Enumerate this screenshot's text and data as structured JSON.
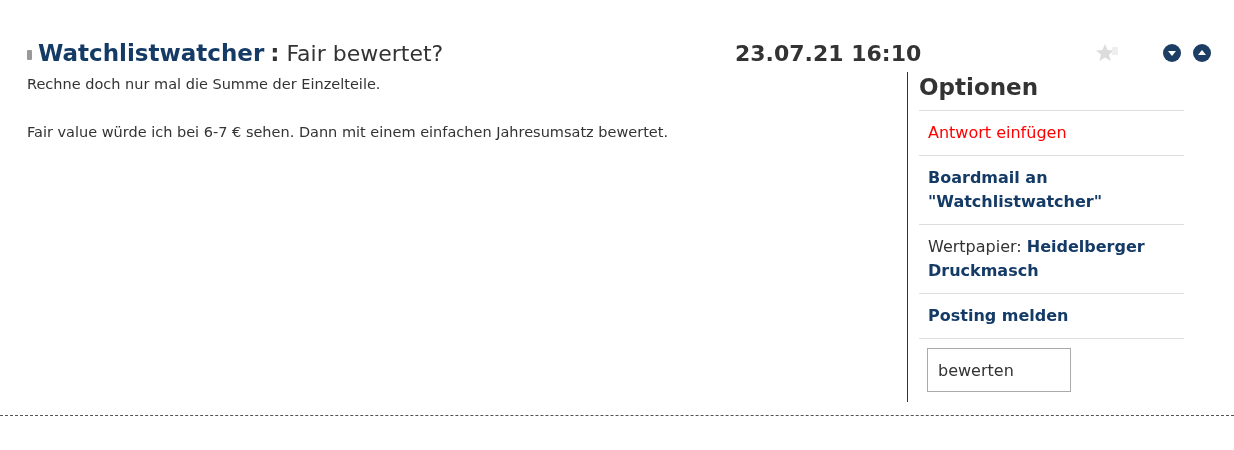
{
  "post": {
    "author": "Watchlistwatcher",
    "separator": ":",
    "title": "Fair bewertet?",
    "date": "23.07.21 16:10",
    "paragraphs": [
      "Rechne doch nur mal die Summe der Einzelteile.",
      "Fair value würde ich bei 6-7 € sehen. Dann mit einem einfachen Jahresumsatz bewertet."
    ]
  },
  "options": {
    "title": "Optionen",
    "items": [
      {
        "kind": "action",
        "text": "Antwort einfügen"
      },
      {
        "kind": "link",
        "text": "Boardmail an \"Watchlistwatcher\""
      },
      {
        "kind": "labeled",
        "label": "Wertpapier:",
        "text": "Heidelberger Druckmasch"
      },
      {
        "kind": "link",
        "text": "Posting melden"
      }
    ],
    "button": "bewerten"
  }
}
